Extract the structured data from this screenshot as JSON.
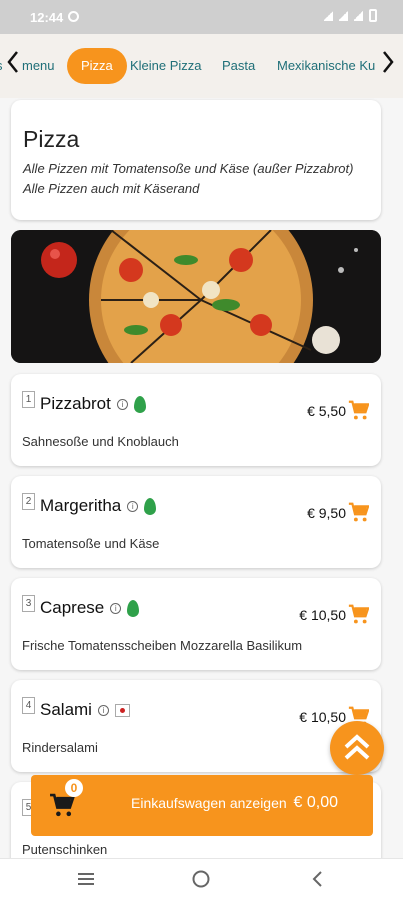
{
  "status_bar": {
    "time": "12:44"
  },
  "category_bar": {
    "categories": [
      {
        "label": "s"
      },
      {
        "label": "menu"
      },
      {
        "label": "Pizza",
        "active": true
      },
      {
        "label": "Kleine Pizza"
      },
      {
        "label": "Pasta"
      },
      {
        "label": "Mexikanische Ku"
      }
    ]
  },
  "section": {
    "title": "Pizza",
    "description": "Alle Pizzen mit Tomatensoße und Käse (außer Pizzabrot) Alle Pizzen auch mit Käserand"
  },
  "items": [
    {
      "number": "1",
      "name": "Pizzabrot",
      "badge": "vegetarian-leaf",
      "price": "€ 5,50",
      "description": "Sahnesoße und Knoblauch"
    },
    {
      "number": "2",
      "name": "Margeritha",
      "badge": "vegetarian-leaf",
      "price": "€ 9,50",
      "description": "Tomatensoße und Käse"
    },
    {
      "number": "3",
      "name": "Caprese",
      "badge": "vegetarian-leaf",
      "price": "€ 10,50",
      "description": "Frische Tomatensscheiben Mozzarella Basilikum"
    },
    {
      "number": "4",
      "name": "Salami",
      "badge": "flag-icon",
      "price": "€ 10,50",
      "description": "Rindersalami"
    },
    {
      "number": "5",
      "name": "",
      "badge": "",
      "price": "",
      "description": "Putenschinken"
    }
  ],
  "cart_bar": {
    "count": "0",
    "label": "Einkaufswagen anzeigen",
    "total": "€ 0,00"
  },
  "colors": {
    "accent": "#f7941d",
    "link": "#1f6f78",
    "leaf": "#2fa14a"
  }
}
